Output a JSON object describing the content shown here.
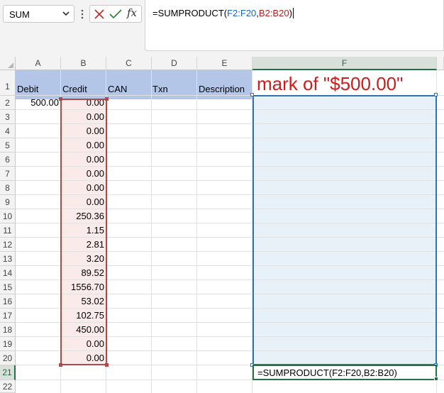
{
  "formula_bar": {
    "name_box": "SUM",
    "formula_prefix": "=SUMPRODUCT(",
    "ref_1": "F2:F20",
    "separator": ",",
    "ref_2": "B2:B20",
    "formula_suffix": ")",
    "fx_label": "fx"
  },
  "columns": [
    "A",
    "B",
    "C",
    "D",
    "E",
    "F"
  ],
  "rows": [
    "1",
    "2",
    "3",
    "4",
    "5",
    "6",
    "7",
    "8",
    "9",
    "10",
    "11",
    "12",
    "13",
    "14",
    "15",
    "16",
    "17",
    "18",
    "19",
    "20",
    "21",
    "22"
  ],
  "headers": {
    "a": "Debit",
    "b": "Credit",
    "c": "CAN",
    "d": "Txn",
    "e": "Description"
  },
  "debit_values": [
    "500.00"
  ],
  "credit_values": [
    "0.00",
    "0.00",
    "0.00",
    "0.00",
    "0.00",
    "0.00",
    "0.00",
    "0.00",
    "250.36",
    "1.15",
    "2.81",
    "3.20",
    "89.52",
    "1556.70",
    "53.02",
    "102.75",
    "450.00",
    "0.00",
    "0.00"
  ],
  "annotation": "mark of \"$500.00\"",
  "active_cell": {
    "reference": "F21",
    "text": "=SUMPRODUCT(F2:F20,B2:B20)"
  },
  "colors": {
    "header_fill": "#b4c6e7",
    "credit_range": "#b04a4a",
    "f_range": "#2e74b5",
    "annotation": "#d11b1b",
    "active_border": "#217346"
  }
}
